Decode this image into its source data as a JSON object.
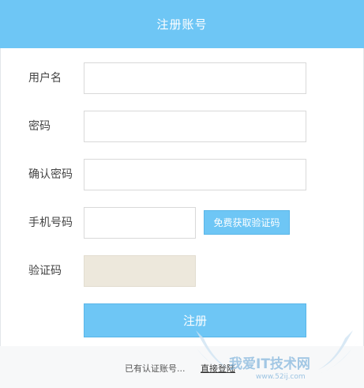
{
  "header": {
    "title": "注册账号"
  },
  "form": {
    "username": {
      "label": "用户名",
      "value": ""
    },
    "password": {
      "label": "密码",
      "value": ""
    },
    "confirm_password": {
      "label": "确认密码",
      "value": ""
    },
    "phone": {
      "label": "手机号码",
      "value": ""
    },
    "sms_button_label": "免费获取验证码",
    "captcha": {
      "label": "验证码",
      "value": ""
    },
    "submit_label": "注册"
  },
  "footer": {
    "prompt": "已有认证账号...",
    "login_link": "直接登陆"
  },
  "watermark": {
    "text": "我爱IT技术网",
    "url": "www.52ij.com"
  },
  "colors": {
    "accent": "#6ec6f5",
    "captcha_bg": "#ede8dc",
    "border": "#d9d9d9"
  }
}
